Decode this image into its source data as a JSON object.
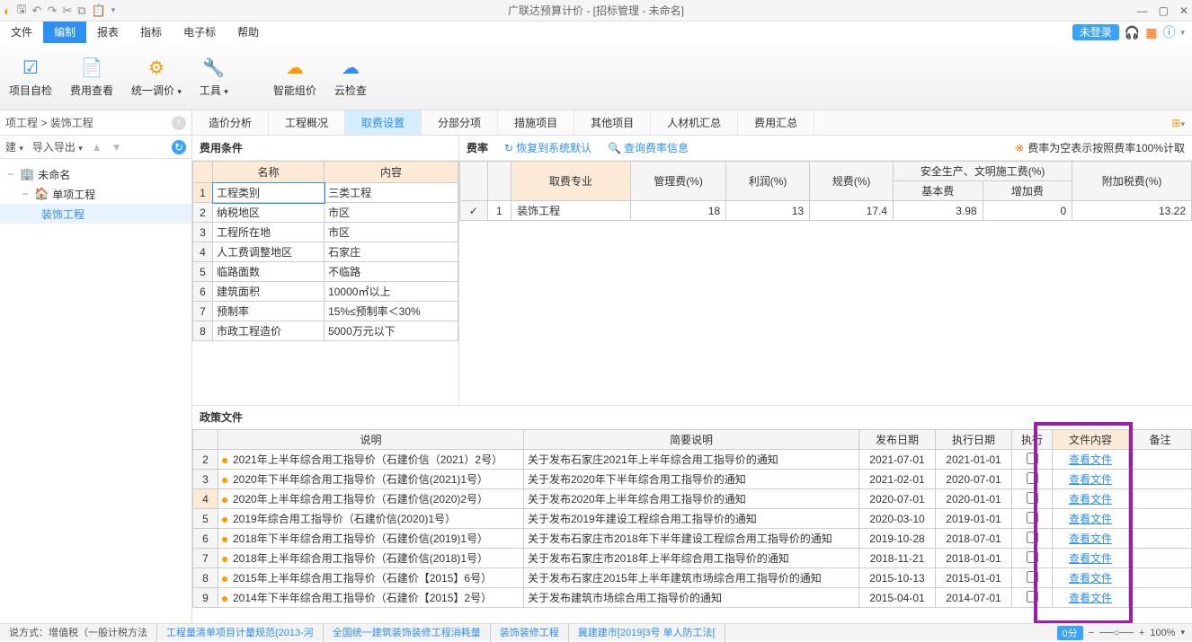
{
  "title": "广联达预算计价 - [招标管理 - 未命名]",
  "menu": [
    "文件",
    "编制",
    "报表",
    "指标",
    "电子标",
    "帮助"
  ],
  "login": "未登录",
  "ribbon": [
    {
      "label": "项目自检",
      "name": "self-check"
    },
    {
      "label": "费用查看",
      "name": "fee-view"
    },
    {
      "label": "统一调价",
      "name": "adjust-price"
    },
    {
      "label": "工具",
      "name": "tools"
    },
    {
      "label": "智能组价",
      "name": "smart-price"
    },
    {
      "label": "云检查",
      "name": "cloud-check"
    }
  ],
  "breadcrumb": {
    "a": "项工程",
    "sep": ">",
    "b": "装饰工程"
  },
  "toolrow": {
    "new": "建",
    "io": "导入导出"
  },
  "tree": {
    "root": "未命名",
    "l1": "单项工程",
    "l2": "装饰工程"
  },
  "tabs": [
    "造价分析",
    "工程概况",
    "取费设置",
    "分部分项",
    "措施项目",
    "其他项目",
    "人材机汇总",
    "费用汇总"
  ],
  "active_tab": 2,
  "cond": {
    "title": "费用条件",
    "headers": [
      "名称",
      "内容"
    ],
    "rows": [
      {
        "n": "1",
        "name": "工程类别",
        "val": "三类工程",
        "sel": true
      },
      {
        "n": "2",
        "name": "纳税地区",
        "val": "市区"
      },
      {
        "n": "3",
        "name": "工程所在地",
        "val": "市区"
      },
      {
        "n": "4",
        "name": "人工费调整地区",
        "val": "石家庄"
      },
      {
        "n": "5",
        "name": "临路面数",
        "val": "不临路"
      },
      {
        "n": "6",
        "name": "建筑面积",
        "val": "10000㎡以上"
      },
      {
        "n": "7",
        "name": "预制率",
        "val": "15%≤预制率＜30%"
      },
      {
        "n": "8",
        "name": "市政工程造价",
        "val": "5000万元以下"
      }
    ]
  },
  "rate": {
    "title": "费率",
    "restore": "恢复到系统默认",
    "query": "查询费率信息",
    "warn": "费率为空表示按照费率100%计取",
    "top_headers": [
      "取费专业",
      "管理费(%)",
      "利润(%)",
      "规费(%)",
      "安全生产、文明施工费(%)",
      "附加税费(%)"
    ],
    "sub_headers": [
      "基本费",
      "增加费"
    ],
    "row": {
      "idx": "1",
      "name": "装饰工程",
      "mgmt": "18",
      "profit": "13",
      "reg": "17.4",
      "base": "3.98",
      "add": "0",
      "tax": "13.22"
    }
  },
  "policy": {
    "title": "政策文件",
    "headers": [
      "",
      "说明",
      "简要说明",
      "发布日期",
      "执行日期",
      "执行",
      "文件内容",
      "备注"
    ],
    "link": "查看文件",
    "rows": [
      {
        "n": "2",
        "desc": "2021年上半年综合用工指导价（石建价信（2021）2号）",
        "brief": "关于发布石家庄2021年上半年综合用工指导价的通知",
        "pub": "2021-07-01",
        "exec": "2021-01-01"
      },
      {
        "n": "3",
        "desc": "2020年下半年综合用工指导价（石建价信(2021)1号）",
        "brief": "关于发布2020年下半年综合用工指导价的通知",
        "pub": "2021-02-01",
        "exec": "2020-07-01"
      },
      {
        "n": "4",
        "desc": "2020年上半年综合用工指导价（石建价信(2020)2号）",
        "brief": "关于发布2020年上半年综合用工指导价的通知",
        "pub": "2020-07-01",
        "exec": "2020-01-01",
        "sel": true
      },
      {
        "n": "5",
        "desc": "2019年综合用工指导价（石建价信(2020)1号）",
        "brief": "关于发布2019年建设工程综合用工指导价的通知",
        "pub": "2020-03-10",
        "exec": "2019-01-01"
      },
      {
        "n": "6",
        "desc": "2018年下半年综合用工指导价（石建价信(2019)1号）",
        "brief": "关于发布石家庄市2018年下半年建设工程综合用工指导价的通知",
        "pub": "2019-10-28",
        "exec": "2018-07-01"
      },
      {
        "n": "7",
        "desc": "2018年上半年综合用工指导价（石建价信(2018)1号）",
        "brief": "关于发布石家庄市2018年上半年综合用工指导价的通知",
        "pub": "2018-11-21",
        "exec": "2018-01-01"
      },
      {
        "n": "8",
        "desc": "2015年上半年综合用工指导价（石建价【2015】6号）",
        "brief": "关于发布石家庄2015年上半年建筑市场综合用工指导价的通知",
        "pub": "2015-10-13",
        "exec": "2015-01-01"
      },
      {
        "n": "9",
        "desc": "2014年下半年综合用工指导价（石建价【2015】2号）",
        "brief": "关于发布建筑市场综合用工指导价的通知",
        "pub": "2015-04-01",
        "exec": "2014-07-01"
      }
    ]
  },
  "status": {
    "s1": "说方式：增值税（一般计税方法",
    "s2": "工程量清单项目计量规范(2013-河",
    "s3": "全国统一建筑装饰装修工程消耗量",
    "s4": "装饰装修工程",
    "s5": "冀建建市[2019]3号  单人防工法[",
    "zero": "0分",
    "zoom": "100%"
  }
}
